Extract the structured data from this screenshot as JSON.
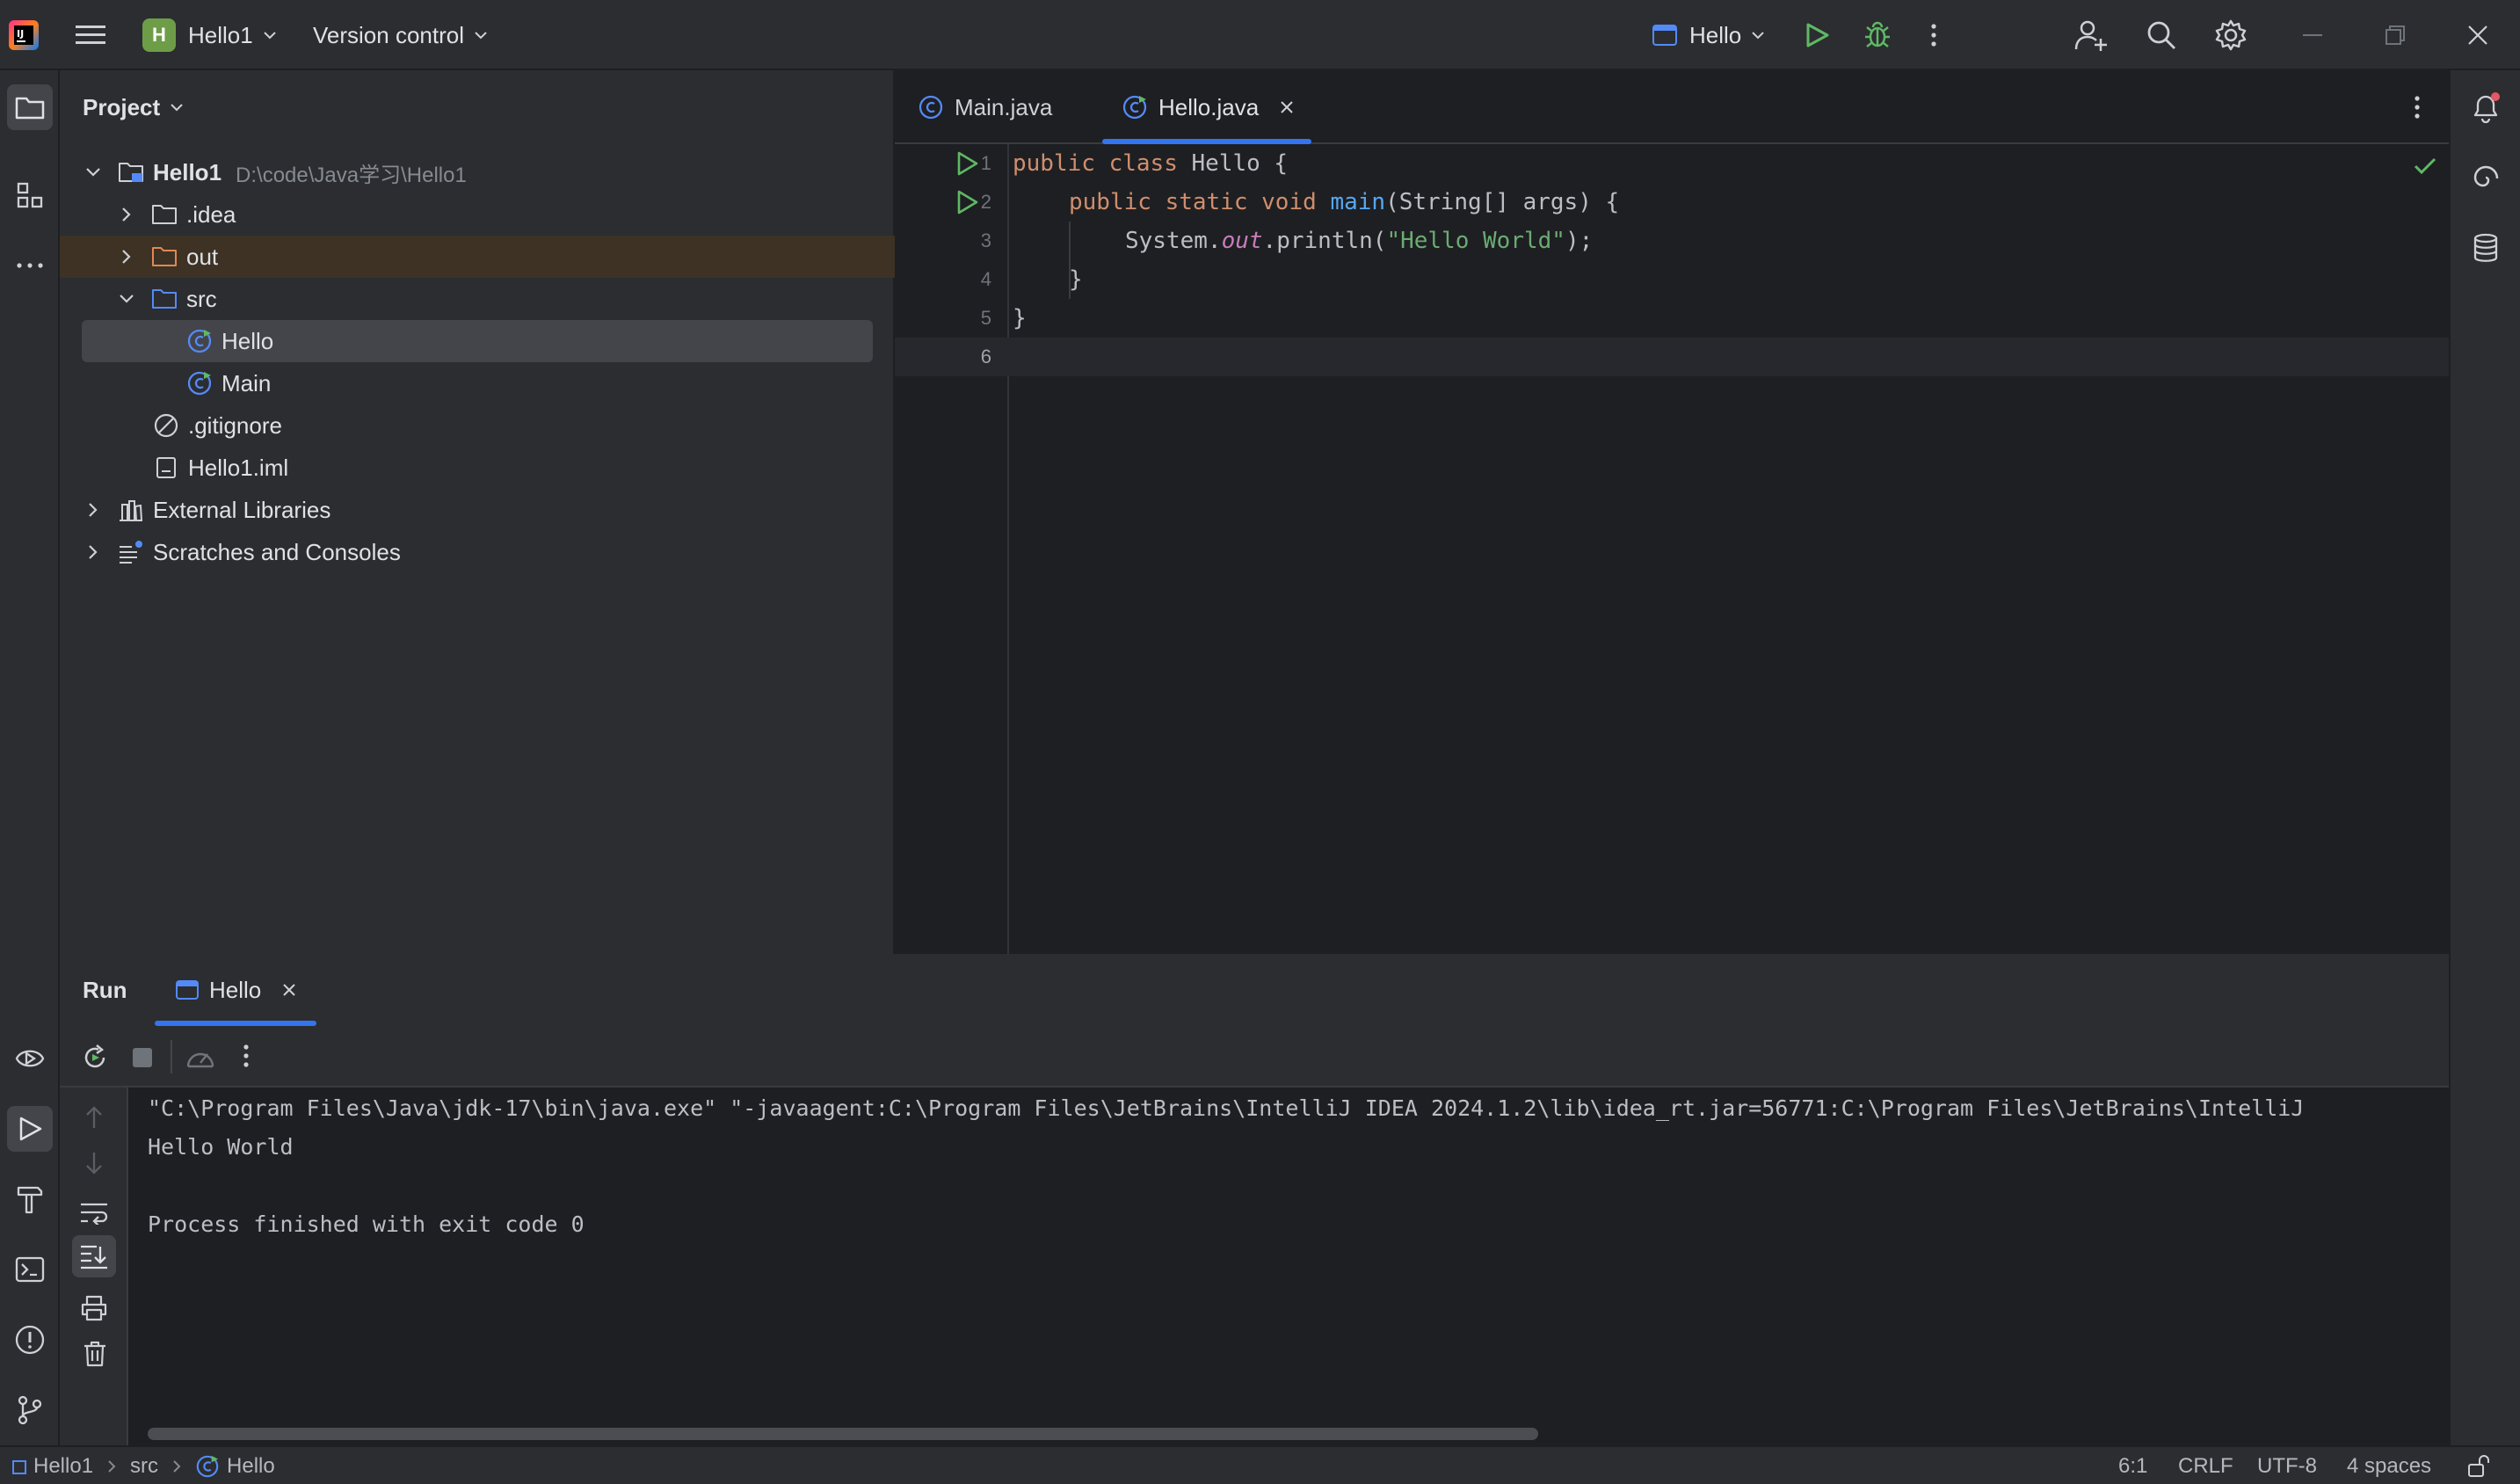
{
  "titlebar": {
    "project_badge": "H",
    "project_name": "Hello1",
    "vcs_label": "Version control",
    "run_config": "Hello"
  },
  "project_panel": {
    "title": "Project",
    "root_name": "Hello1",
    "root_path": "D:\\code\\Java学习\\Hello1",
    "items": [
      {
        "label": ".idea"
      },
      {
        "label": "out"
      },
      {
        "label": "src"
      },
      {
        "label": "Hello"
      },
      {
        "label": "Main"
      },
      {
        "label": ".gitignore"
      },
      {
        "label": "Hello1.iml"
      },
      {
        "label": "External Libraries"
      },
      {
        "label": "Scratches and Consoles"
      }
    ]
  },
  "editor": {
    "tabs": [
      {
        "label": "Main.java"
      },
      {
        "label": "Hello.java"
      }
    ],
    "line_numbers": [
      "1",
      "2",
      "3",
      "4",
      "5",
      "6"
    ],
    "code": {
      "l1_kw1": "public",
      "l1_kw2": "class",
      "l1_rest": " Hello {",
      "l2_kw1": "public",
      "l2_kw2": "static",
      "l2_kw3": "void",
      "l2_fn": "main",
      "l2_rest": "(String[] args) {",
      "l3_a": "System.",
      "l3_b": "out",
      "l3_c": ".println(",
      "l3_str": "\"Hello World\"",
      "l3_d": ");",
      "l4": "}",
      "l5": "}"
    }
  },
  "run": {
    "title": "Run",
    "tab_label": "Hello",
    "output": [
      "\"C:\\Program Files\\Java\\jdk-17\\bin\\java.exe\" \"-javaagent:C:\\Program Files\\JetBrains\\IntelliJ IDEA 2024.1.2\\lib\\idea_rt.jar=56771:C:\\Program Files\\JetBrains\\IntelliJ",
      "Hello World",
      "",
      "Process finished with exit code 0"
    ]
  },
  "statusbar": {
    "crumb1": "Hello1",
    "crumb2": "src",
    "crumb3": "Hello",
    "position": "6:1",
    "line_sep": "CRLF",
    "encoding": "UTF-8",
    "indent": "4 spaces"
  },
  "colors": {
    "accent": "#3574f0",
    "run_green": "#5fb865",
    "project_badge": "#6e9d48"
  }
}
